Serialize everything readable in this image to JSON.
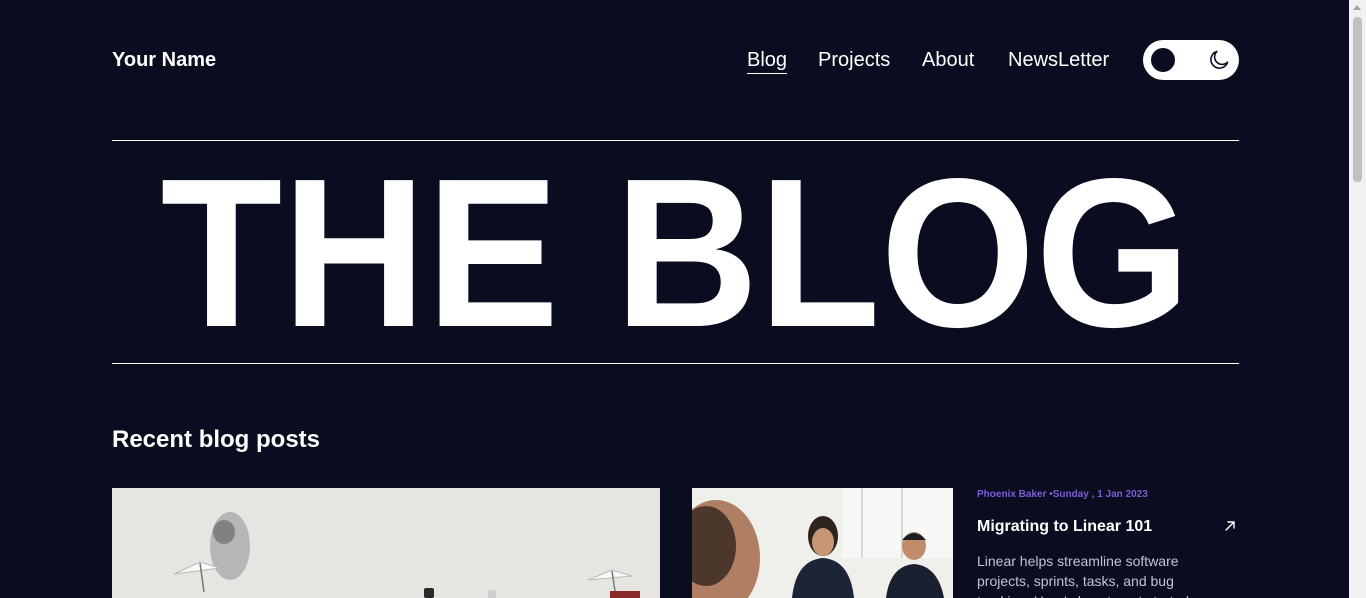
{
  "header": {
    "site_name": "Your Name",
    "nav": [
      {
        "label": "Blog",
        "active": true
      },
      {
        "label": "Projects",
        "active": false
      },
      {
        "label": "About",
        "active": false
      },
      {
        "label": "NewsLetter",
        "active": false
      }
    ],
    "theme_toggle": {
      "icons": [
        "dark-mode-knob",
        "moon-icon"
      ],
      "mode": "dark"
    }
  },
  "hero": {
    "title": "THE BLOG"
  },
  "recent": {
    "heading": "Recent blog posts",
    "posts": [
      {
        "image": "office-desk-photo"
      },
      {
        "image": "meeting-photo",
        "meta": "Phoenix Baker •Sunday , 1 Jan 2023",
        "title": "Migrating to Linear 101",
        "excerpt": "Linear helps streamline software projects, sprints, tasks, and bug tracking. Here's how to get started."
      }
    ]
  },
  "colors": {
    "background": "#090d1f",
    "text": "#ffffff",
    "accent": "#7c5cd6",
    "muted_text": "#c0c5d0"
  }
}
